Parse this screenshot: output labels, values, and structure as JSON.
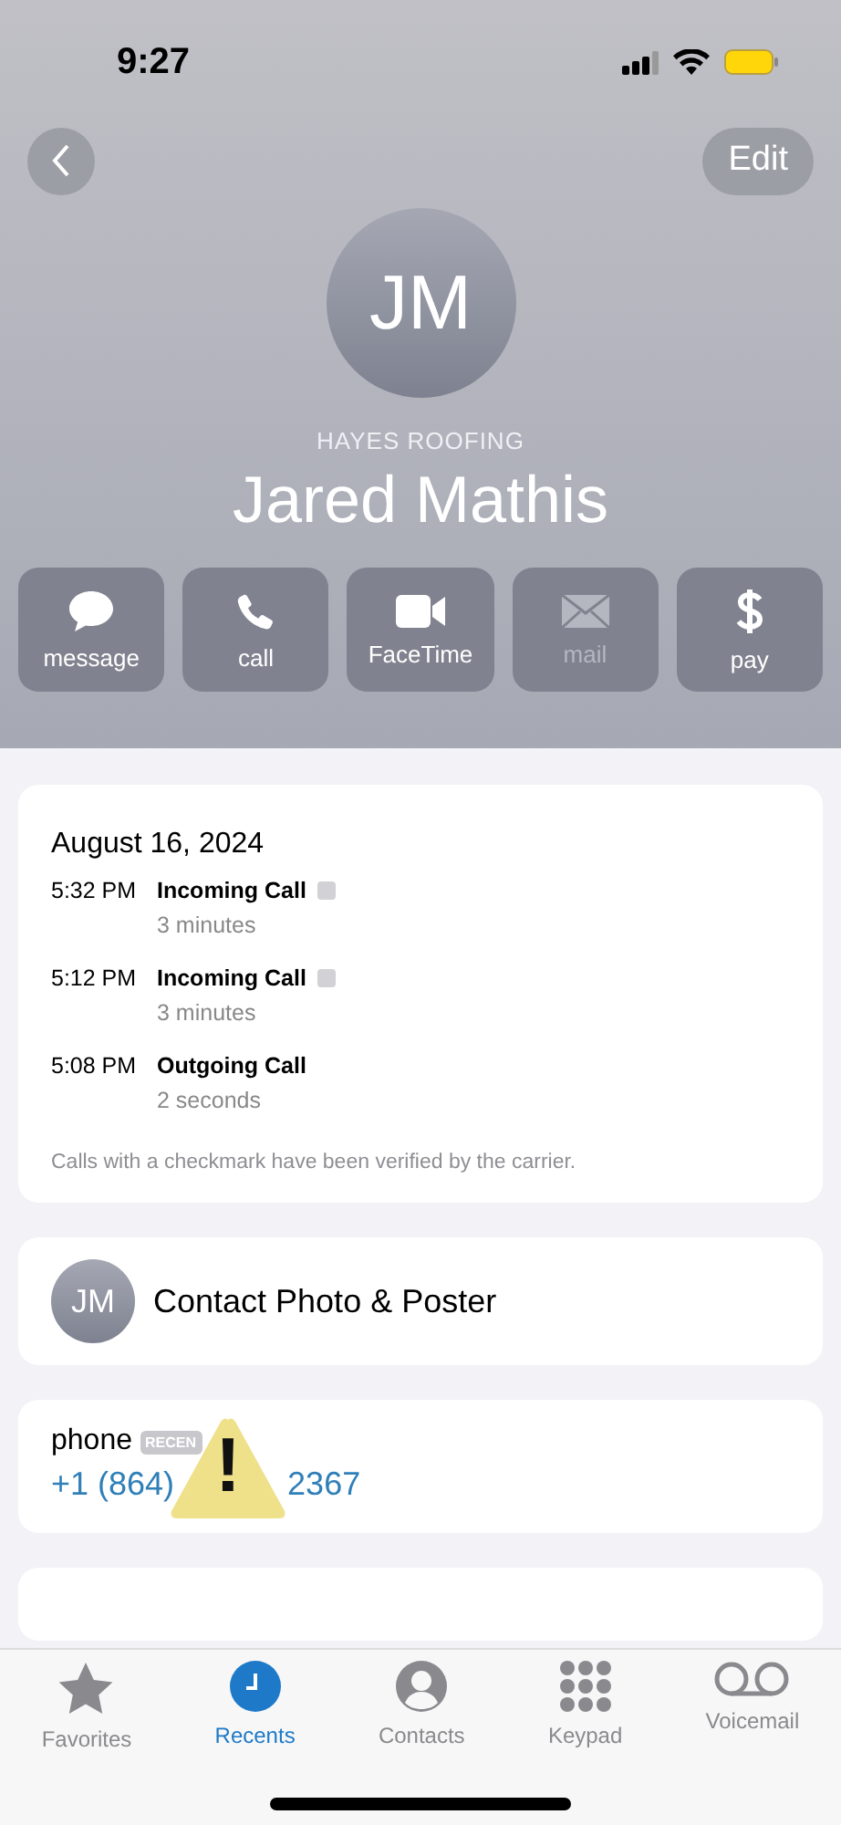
{
  "status_bar": {
    "time": "9:27"
  },
  "nav": {
    "edit": "Edit"
  },
  "contact": {
    "initials": "JM",
    "company": "HAYES ROOFING",
    "name": "Jared Mathis"
  },
  "actions": [
    {
      "kind": "message",
      "label": "message",
      "disabled": false
    },
    {
      "kind": "call",
      "label": "call",
      "disabled": false
    },
    {
      "kind": "video",
      "label": "FaceTime",
      "disabled": false
    },
    {
      "kind": "mail",
      "label": "mail",
      "disabled": true
    },
    {
      "kind": "pay",
      "label": "pay",
      "disabled": false
    }
  ],
  "call_history": {
    "date": "August 16, 2024",
    "calls": [
      {
        "time": "5:32 PM",
        "type": "Incoming Call",
        "verified": true,
        "duration": "3 minutes"
      },
      {
        "time": "5:12 PM",
        "type": "Incoming Call",
        "verified": true,
        "duration": "3 minutes"
      },
      {
        "time": "5:08 PM",
        "type": "Outgoing Call",
        "verified": false,
        "duration": "2 seconds"
      }
    ],
    "note": "Calls with a checkmark have been verified by the carrier."
  },
  "contact_photo": {
    "initials": "JM",
    "label": "Contact Photo & Poster"
  },
  "phone": {
    "label": "phone",
    "badge": "RECEN",
    "number_start": "+1 (864)",
    "number_end": "2367",
    "warning": "!"
  },
  "tab_bar": [
    {
      "kind": "star",
      "label": "Favorites",
      "selected": false
    },
    {
      "kind": "clock",
      "label": "Recents",
      "selected": true
    },
    {
      "kind": "person",
      "label": "Contacts",
      "selected": false
    },
    {
      "kind": "keypad",
      "label": "Keypad",
      "selected": false
    },
    {
      "kind": "voicemail",
      "label": "Voicemail",
      "selected": false
    }
  ]
}
